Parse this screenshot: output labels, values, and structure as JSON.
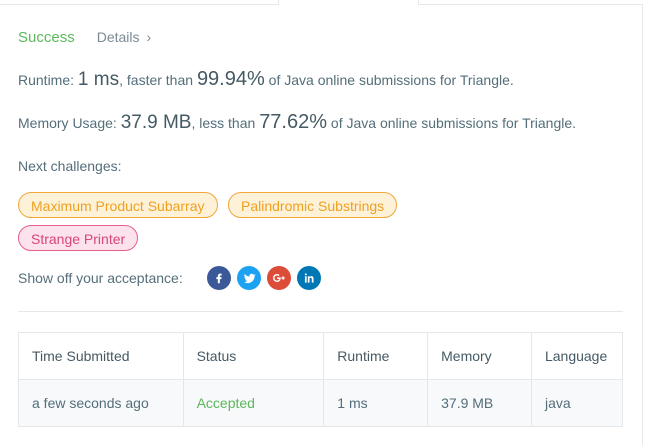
{
  "status": {
    "result": "Success",
    "details_label": "Details",
    "details_chevron": "›"
  },
  "runtime": {
    "label": "Runtime:",
    "value": "1 ms",
    "mid_text": ", faster than",
    "percent": "99.94%",
    "suffix": "of Java online submissions for Triangle."
  },
  "memory": {
    "label": "Memory Usage:",
    "value": "37.9 MB",
    "mid_text": ", less than",
    "percent": "77.62%",
    "suffix": "of Java online submissions for Triangle."
  },
  "next": {
    "label": "Next challenges:",
    "challenges": [
      {
        "title": "Maximum Product Subarray",
        "difficulty": "medium"
      },
      {
        "title": "Palindromic Substrings",
        "difficulty": "medium"
      },
      {
        "title": "Strange Printer",
        "difficulty": "hard"
      }
    ]
  },
  "share": {
    "label": "Show off your acceptance:",
    "icons": [
      "facebook-icon",
      "twitter-icon",
      "google-plus-icon",
      "linkedin-icon"
    ]
  },
  "table": {
    "headers": [
      "Time Submitted",
      "Status",
      "Runtime",
      "Memory",
      "Language"
    ],
    "rows": [
      [
        "a few seconds ago",
        "Accepted",
        "1 ms",
        "37.9 MB",
        "java"
      ]
    ]
  },
  "colors": {
    "success": "#5cb85c",
    "medium": "#f0a020",
    "hard": "#d9467a",
    "facebook": "#3b5998",
    "twitter": "#1da1f2",
    "google_plus": "#dd4b39",
    "linkedin": "#0077b5"
  }
}
